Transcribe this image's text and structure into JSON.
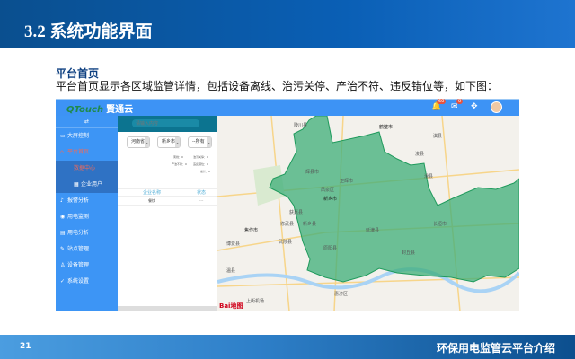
{
  "slide": {
    "title": "3.2 系统功能界面",
    "subtitle": "平台首页",
    "description": "平台首页显示各区域监管详情，包括设备离线、治污关停、产治不符、违反错位等，如下图：",
    "page_number": "21",
    "footer": "环保用电监管云平台介绍"
  },
  "app": {
    "logo": "QTouch",
    "logo_cn": "賢通云",
    "topbar": {
      "alarm_count": "60",
      "mail_count": "0"
    },
    "sidebar": {
      "toggle": "⇄",
      "items": [
        {
          "label": "大屏控制",
          "icon": "monitor-icon",
          "sub": false
        },
        {
          "label": "平台首页",
          "icon": "home-icon",
          "sub": false,
          "active": true
        },
        {
          "label": "数据中心",
          "icon": "",
          "sub": true,
          "active": true
        },
        {
          "label": "企业用户",
          "icon": "grid-icon",
          "sub": true
        },
        {
          "label": "报警分析",
          "icon": "bell-icon",
          "sub": false
        },
        {
          "label": "用电监测",
          "icon": "eye-icon",
          "sub": false
        },
        {
          "label": "用电分析",
          "icon": "chart-icon",
          "sub": false
        },
        {
          "label": "站点管理",
          "icon": "pin-icon",
          "sub": false
        },
        {
          "label": "设备管理",
          "icon": "sitemap-icon",
          "sub": false
        },
        {
          "label": "系统设置",
          "icon": "wrench-icon",
          "sub": false
        }
      ]
    },
    "panel": {
      "search_placeholder": "请输入内容",
      "province": "河南省",
      "city": "新乡市",
      "district": "--所有",
      "stats": [
        "离线：0",
        "治污关停：0",
        "产治不符：0",
        "违反错位：0",
        "总计：0"
      ],
      "table_headers": [
        "企业名称",
        "状态"
      ],
      "row": [
        "餐饮",
        "---"
      ]
    },
    "map": {
      "labels": [
        "陵川县",
        "辉县市",
        "卫辉市",
        "凤泉区",
        "新乡市",
        "获嘉县",
        "新乡县",
        "原阳县",
        "延津县",
        "封丘县",
        "长垣市",
        "焦作市",
        "修武县",
        "武陟县",
        "博爱县",
        "温县",
        "惠济区",
        "鹤壁市",
        "浚县",
        "滑县",
        "淇县",
        "上街机场"
      ],
      "region_color": "#3dae78"
    }
  }
}
